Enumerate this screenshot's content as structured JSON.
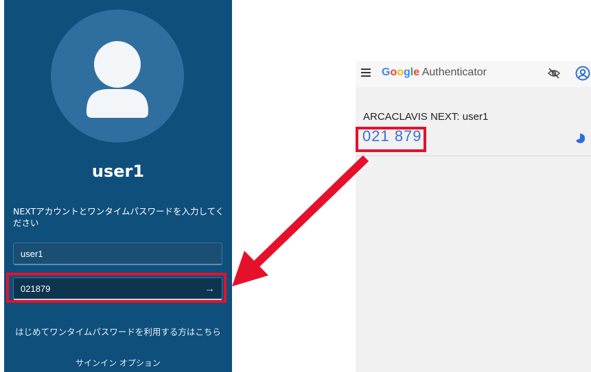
{
  "login": {
    "username": "user1",
    "instruction": "NEXTアカウントとワンタイムパスワードを入力してください",
    "user_field_value": "user1",
    "otp_field_value": "021879",
    "submit_arrow": "→",
    "first_time_link": "はじめてワンタイムパスワードを利用する方はこちら",
    "signin_options": "サインイン オプション"
  },
  "authenticator": {
    "title_brand": [
      "G",
      "o",
      "o",
      "g",
      "l",
      "e"
    ],
    "title_word": "Authenticator",
    "account": "ARCACLAVIS NEXT: user1",
    "code": "021 879",
    "icons": [
      "menu-icon",
      "eye-off-icon",
      "account-circle-icon",
      "timer-icon"
    ]
  },
  "annotation": {
    "color": "#e5112b"
  }
}
